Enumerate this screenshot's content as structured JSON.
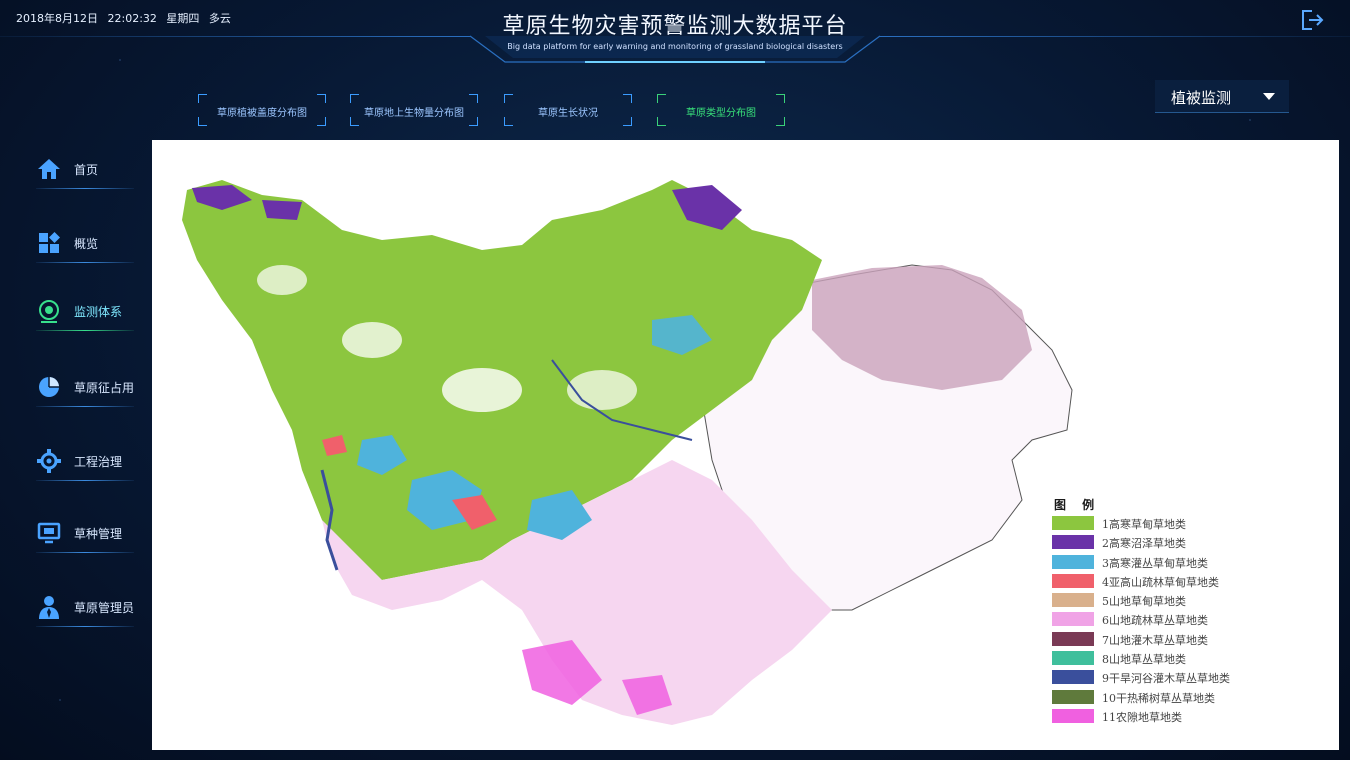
{
  "header": {
    "date": "2018年8月12日",
    "time": "22:02:32",
    "weekday": "星期四",
    "weather": "多云",
    "title": "草原生物灾害预警监测大数据平台",
    "subtitle": "Big data platform for early warning and monitoring of grassland biological disasters"
  },
  "tabs": [
    {
      "label": "草原植被盖度分布图"
    },
    {
      "label": "草原地上生物量分布图"
    },
    {
      "label": "草原生长状况"
    },
    {
      "label": "草原类型分布图"
    }
  ],
  "dropdown": {
    "selected": "植被监测"
  },
  "sidebar": {
    "items": [
      {
        "label": "首页",
        "icon": "home-icon"
      },
      {
        "label": "概览",
        "icon": "dashboard-icon"
      },
      {
        "label": "监测体系",
        "icon": "monitor-icon"
      },
      {
        "label": "草原征占用",
        "icon": "pie-chart-icon"
      },
      {
        "label": "工程治理",
        "icon": "gear-icon"
      },
      {
        "label": "草种管理",
        "icon": "screen-icon"
      },
      {
        "label": "草原管理员",
        "icon": "admin-icon"
      }
    ]
  },
  "legend": {
    "title": "图 例",
    "items": [
      {
        "label": "1高寒草甸草地类",
        "color": "#8cc63f"
      },
      {
        "label": "2高寒沼泽草地类",
        "color": "#6a32a8"
      },
      {
        "label": "3高寒灌丛草甸草地类",
        "color": "#4fb3dc"
      },
      {
        "label": "4亚高山疏林草甸草地类",
        "color": "#f0606b"
      },
      {
        "label": "5山地草甸草地类",
        "color": "#d9b08c"
      },
      {
        "label": "6山地疏林草丛草地类",
        "color": "#f0a3e6"
      },
      {
        "label": "7山地灌木草丛草地类",
        "color": "#7a3a55"
      },
      {
        "label": "8山地草丛草地类",
        "color": "#3fbf9c"
      },
      {
        "label": "9干旱河谷灌木草丛草地类",
        "color": "#3a4f9c"
      },
      {
        "label": "10干热稀树草丛草地类",
        "color": "#5f7a3c"
      },
      {
        "label": "11农隙地草地类",
        "color": "#f060e0"
      }
    ]
  },
  "colors": {
    "accent": "#3b9cff",
    "active_tab": "#38e07a",
    "background": "#071833"
  }
}
